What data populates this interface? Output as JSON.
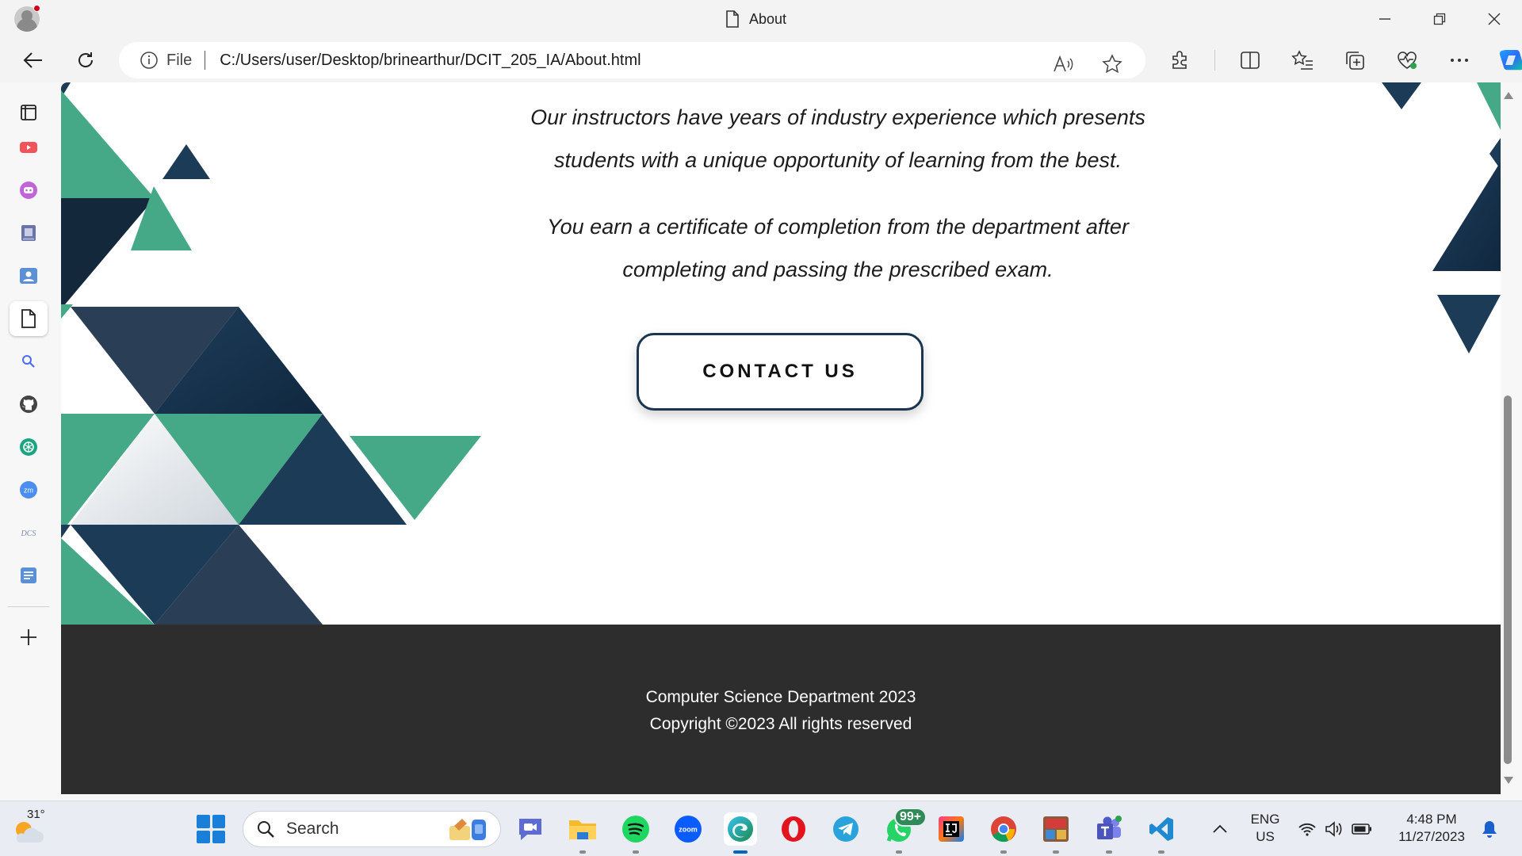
{
  "browser": {
    "tab_title": "About",
    "url_scheme": "File",
    "url": "C:/Users/user/Desktop/brinearthur/DCIT_205_IA/About.html"
  },
  "page": {
    "paragraph1_line1": "Our instructors have years of industry experience which presents",
    "paragraph1_line2": "students with a unique opportunity of learning from the best.",
    "paragraph2_line1": "You earn a certificate of completion from the department after",
    "paragraph2_line2": "completing and passing the prescribed exam.",
    "contact_button": "CONTACT US",
    "footer_line1": "Computer Science Department 2023",
    "footer_line2": "Copyright ©2023 All rights reserved"
  },
  "colors": {
    "accent_green": "#45a987",
    "navy": "#1c3b57",
    "dark_navy": "#14283b",
    "footer_bg": "#2d2d2d"
  },
  "taskbar": {
    "weather_temp": "31°",
    "search_label": "Search",
    "whatsapp_badge": "99+",
    "lang_line1": "ENG",
    "lang_line2": "US",
    "time": "4:48 PM",
    "date": "11/27/2023"
  }
}
